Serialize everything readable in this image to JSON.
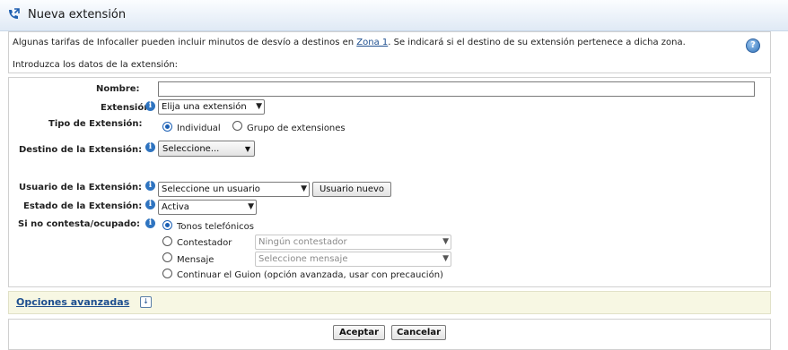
{
  "window": {
    "title": "Nueva extensión",
    "icon": "phone-forward-icon"
  },
  "info": {
    "line1_prefix": "Algunas tarifas de Infocaller pueden incluir minutos de desvío a destinos en ",
    "zone_link": "Zona 1",
    "line1_suffix": ". Se indicará si el destino de su extensión pertenece a dicha zona.",
    "line2": "Introduzca los datos de la extensión:",
    "help_icon": "help-icon"
  },
  "form": {
    "nombre_label": "Nombre:",
    "nombre_value": "",
    "extension_label": "Extensión:",
    "extension_value": "Elija una extensión",
    "tipo_label": "Tipo de Extensión:",
    "tipo_options": [
      "Individual",
      "Grupo de extensiones"
    ],
    "tipo_selected": "Individual",
    "destino_label": "Destino de la Extensión:",
    "destino_value": "Seleccione...",
    "usuario_label": "Usuario de la Extensión:",
    "usuario_value": "Seleccione un usuario",
    "usuario_nuevo_button": "Usuario nuevo",
    "estado_label": "Estado de la Extensión:",
    "estado_value": "Activa",
    "nocontesta_label": "Si no contesta/ocupado:",
    "nocontesta_options": {
      "tonos": "Tonos telefónicos",
      "contestador": "Contestador",
      "mensaje": "Mensaje",
      "continuar": "Continuar el Guion (opción avanzada, usar con precaución)"
    },
    "nocontesta_selected": "Tonos telefónicos",
    "contestador_select": "Ningún contestador",
    "mensaje_select": "Seleccione mensaje"
  },
  "advanced": {
    "label": "Opciones avanzadas"
  },
  "footer": {
    "accept": "Aceptar",
    "cancel": "Cancelar"
  },
  "colors": {
    "link": "#1e4f8f",
    "info_icon": "#2f74c0",
    "advanced_bg": "#f7f7e3",
    "titlebar": "#dfe9f5"
  }
}
